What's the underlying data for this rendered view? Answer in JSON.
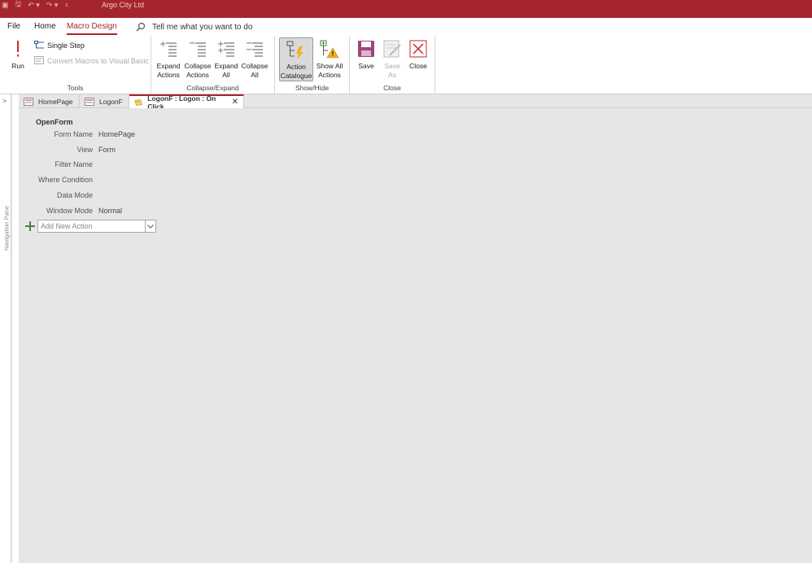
{
  "titlebar": {
    "title": "Argo City Ltd"
  },
  "menu": {
    "file": "File",
    "home": "Home",
    "macro_design": "Macro Design",
    "tell_me": "Tell me what you want to do"
  },
  "ribbon": {
    "tools": {
      "label": "Tools",
      "run": "Run",
      "single_step": "Single Step",
      "convert": "Convert Macros to Visual Basic"
    },
    "collapse_expand": {
      "label": "Collapse/Expand",
      "expand_actions_1": "Expand",
      "expand_actions_2": "Actions",
      "collapse_actions_1": "Collapse",
      "collapse_actions_2": "Actions",
      "expand_all_1": "Expand",
      "expand_all_2": "All",
      "collapse_all_1": "Collapse",
      "collapse_all_2": "All"
    },
    "show_hide": {
      "label": "Show/Hide",
      "action_catalogue_1": "Action",
      "action_catalogue_2": "Catalogue",
      "show_all_actions_1": "Show All",
      "show_all_actions_2": "Actions"
    },
    "close": {
      "label": "Close",
      "save": "Save",
      "save_as_1": "Save",
      "save_as_2": "As",
      "close": "Close"
    }
  },
  "navpane": {
    "label": "Navigation Pane"
  },
  "doc_tabs": [
    {
      "label": "HomePage"
    },
    {
      "label": "LogonF"
    },
    {
      "label": "LogonF : Logon : On Click"
    }
  ],
  "macro": {
    "action": "OpenForm",
    "args": [
      {
        "label": "Form Name",
        "value": "HomePage"
      },
      {
        "label": "View",
        "value": "Form"
      },
      {
        "label": "Filter Name",
        "value": ""
      },
      {
        "label": "Where Condition",
        "value": ""
      },
      {
        "label": "Data Mode",
        "value": ""
      },
      {
        "label": "Window Mode",
        "value": "Normal"
      }
    ],
    "add_new_action": "Add New Action"
  },
  "colors": {
    "accent": "#a4262c",
    "background": "#e6e6e6"
  }
}
